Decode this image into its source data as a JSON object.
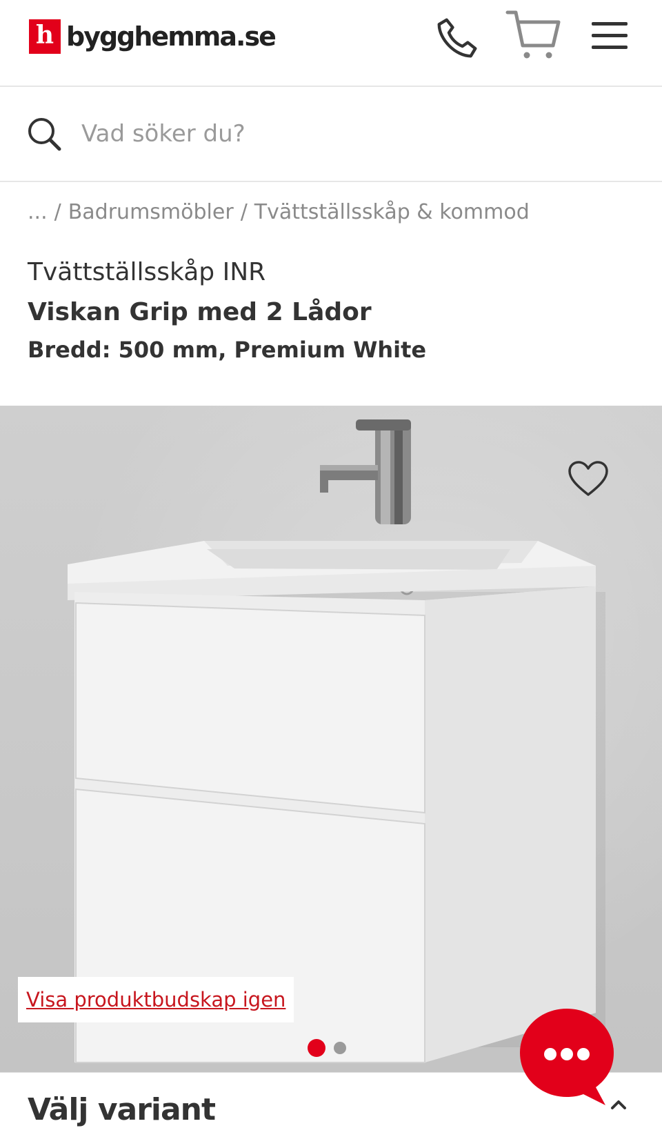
{
  "header": {
    "logo_letter": "h",
    "logo_text": "bygghemma.se",
    "icons": {
      "phone": "phone-icon",
      "cart": "cart-icon",
      "menu": "hamburger-menu-icon"
    }
  },
  "search": {
    "placeholder": "Vad söker du?"
  },
  "breadcrumb": {
    "ellipsis": "...",
    "items": [
      "Badrumsmöbler",
      "Tvättställsskåp & kommod"
    ],
    "separator": "/"
  },
  "product": {
    "brand_line": "Tvättställsskåp INR",
    "name": "Viskan Grip med 2 Lådor",
    "variant_line": "Bredd: 500 mm, Premium White"
  },
  "gallery": {
    "show_message_label": "Visa produktbudskap igen",
    "total_images": 2,
    "active_image": 1,
    "favorite_icon": "heart-outline-icon"
  },
  "variant_section": {
    "title": "Välj variant",
    "icon": "chevron-up-icon"
  },
  "chat": {
    "icon": "chat-bubble-dots-icon"
  },
  "colors": {
    "brand_red": "#e2001a",
    "link_red": "#c7161e",
    "text_dark": "#333333",
    "text_muted": "#8a8a8a"
  }
}
